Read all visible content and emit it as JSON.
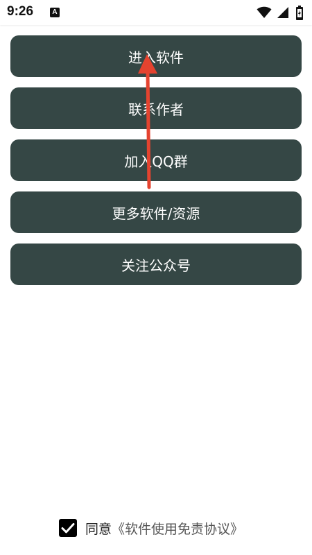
{
  "status_bar": {
    "time": "9:26",
    "notification_letter": "A",
    "icons": [
      "a-notification-icon",
      "wifi-icon",
      "signal-icon",
      "battery-icon"
    ]
  },
  "menu": {
    "items": [
      {
        "label": "进入软件"
      },
      {
        "label": "联系作者"
      },
      {
        "label": "加入QQ群"
      },
      {
        "label": "更多软件/资源"
      },
      {
        "label": "关注公众号"
      }
    ],
    "button_color": "#354745",
    "text_color": "#ffffff"
  },
  "annotation": {
    "arrow_color": "#e5432f"
  },
  "agreement": {
    "checked": true,
    "agree_label": "同意",
    "link_label": "《软件使用免责协议》"
  }
}
